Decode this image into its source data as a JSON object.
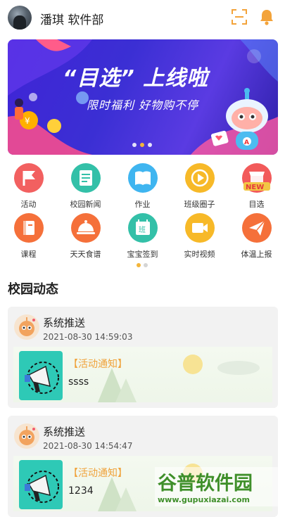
{
  "header": {
    "username": "潘琪 软件部",
    "scan_icon": "scan-icon",
    "bell_icon": "bell-icon",
    "accent_color": "#f3a33a"
  },
  "banner": {
    "title": "“目选” 上线啦",
    "subtitle": "限时福利 好物购不停",
    "active_index": 1,
    "slides": 3
  },
  "grid": {
    "items": [
      {
        "label": "活动",
        "icon": "flag-icon",
        "color": "#f26060"
      },
      {
        "label": "校园新闻",
        "icon": "news-icon",
        "color": "#33c0a8"
      },
      {
        "label": "作业",
        "icon": "book-icon",
        "color": "#3fb5f0"
      },
      {
        "label": "班级圈子",
        "icon": "play-circle-icon",
        "color": "#f7b928"
      },
      {
        "label": "目选",
        "icon": "shop-new-icon",
        "color": "#f25a5a"
      },
      {
        "label": "课程",
        "icon": "course-book-icon",
        "color": "#f5703a"
      },
      {
        "label": "天天食谱",
        "icon": "dish-cover-icon",
        "color": "#f5703a"
      },
      {
        "label": "宝宝签到",
        "icon": "calendar-sign-icon",
        "color": "#33c0a8"
      },
      {
        "label": "实时视频",
        "icon": "video-camera-icon",
        "color": "#f7b928"
      },
      {
        "label": "体温上报",
        "icon": "paper-plane-icon",
        "color": "#f5703a"
      }
    ],
    "page_active": 0
  },
  "section": {
    "title": "校园动态"
  },
  "feed": [
    {
      "sender": "系统推送",
      "time": "2021-08-30 14:59:03",
      "tag": "【活动通知】",
      "body": "ssss"
    },
    {
      "sender": "系统推送",
      "time": "2021-08-30 14:54:47",
      "tag": "【活动通知】",
      "body": "1234"
    }
  ],
  "watermark": {
    "brand": "谷普软件园",
    "url": "www.gupuxiazai.com"
  }
}
